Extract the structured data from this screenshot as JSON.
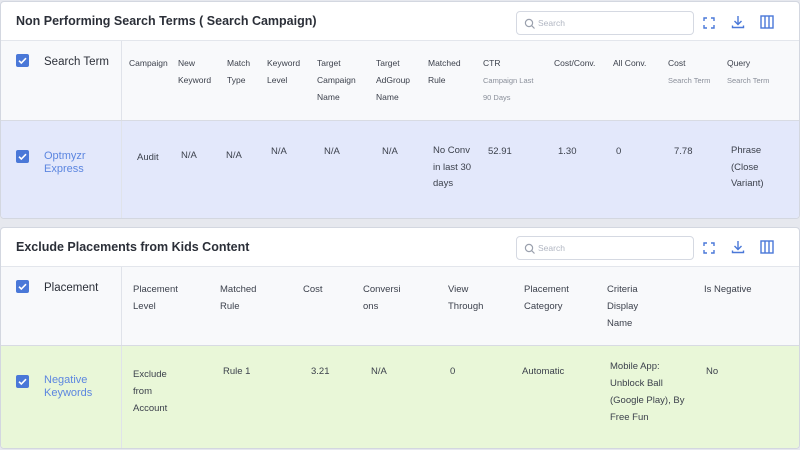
{
  "panel1": {
    "title": "Non Performing Search Terms ( Search Campaign)",
    "search_placeholder": "Search",
    "first_col_header": "Search Term",
    "headers": {
      "campaign": "Campaign",
      "new_keyword": "New Keyword",
      "match_type": "Match Type",
      "keyword_level": "Keyword Level",
      "target_campaign_name": "Target Campaign Name",
      "target_adgroup_name": "Target AdGroup Name",
      "matched_rule": "Matched Rule",
      "ctr": "CTR",
      "ctr_sub": "Campaign Last 90 Days",
      "cost_conv": "Cost/Conv.",
      "all_conv": "All Conv.",
      "cost": "Cost",
      "cost_sub": "Search Term",
      "query": "Query",
      "query_sub": "Search Term"
    },
    "row": {
      "search_term": "Optmyzr Express",
      "campaign": "Audit",
      "new_keyword": "N/A",
      "match_type": "N/A",
      "keyword_level": "N/A",
      "target_campaign_name": "N/A",
      "target_adgroup_name": "N/A",
      "matched_rule": "No Conv in last 30 days",
      "ctr": "52.91",
      "cost_conv": "1.30",
      "all_conv": "0",
      "cost": "7.78",
      "query": "Phrase (Close Variant)"
    }
  },
  "panel2": {
    "title": "Exclude Placements from Kids Content",
    "search_placeholder": "Search",
    "first_col_header": "Placement",
    "headers": {
      "placement_level": "Placement Level",
      "matched_rule": "Matched Rule",
      "cost": "Cost",
      "conversions": "Conversions",
      "view_through": "View Through",
      "placement_category": "Placement Category",
      "criteria_display_name": "Criteria Display Name",
      "is_negative": "Is Negative"
    },
    "row": {
      "placement": "Negative Keywords",
      "placement_level": "Exclude from Account",
      "matched_rule": "Rule 1",
      "cost": "3.21",
      "conversions": "N/A",
      "view_through": "0",
      "placement_category": "Automatic",
      "criteria_display_name": "Mobile App: Unblock Ball (Google Play), By Free Fun",
      "is_negative": "No"
    }
  },
  "colors": {
    "accent": "#4a78d8",
    "row1_bg": "#e3e8fb",
    "row2_bg": "#e9f7d8",
    "link": "#5c86e0"
  }
}
